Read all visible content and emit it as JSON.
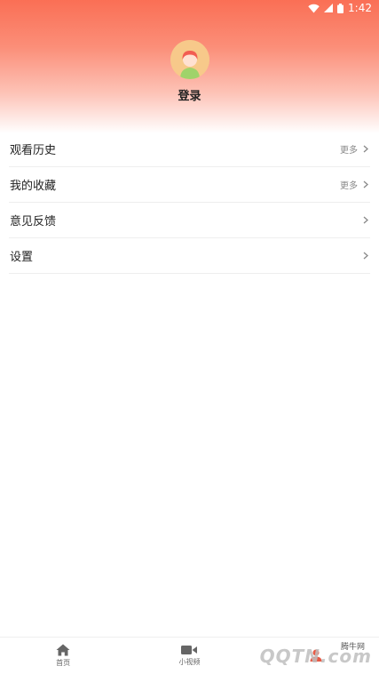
{
  "status_bar": {
    "time": "1:42"
  },
  "profile": {
    "login_label": "登录"
  },
  "menu": {
    "items": [
      {
        "label": "观看历史",
        "more": "更多"
      },
      {
        "label": "我的收藏",
        "more": "更多"
      },
      {
        "label": "意见反馈",
        "more": ""
      },
      {
        "label": "设置",
        "more": ""
      }
    ]
  },
  "bottom_nav": {
    "items": [
      {
        "label": "首页",
        "icon": "home-icon"
      },
      {
        "label": "小视频",
        "icon": "video-camera-icon"
      },
      {
        "label": "",
        "icon": "user-icon"
      }
    ]
  },
  "watermark": {
    "main": "QQTN.com",
    "small": "腾牛网"
  },
  "colors": {
    "accent": "#fa6f55",
    "divider": "#eeeeee"
  }
}
